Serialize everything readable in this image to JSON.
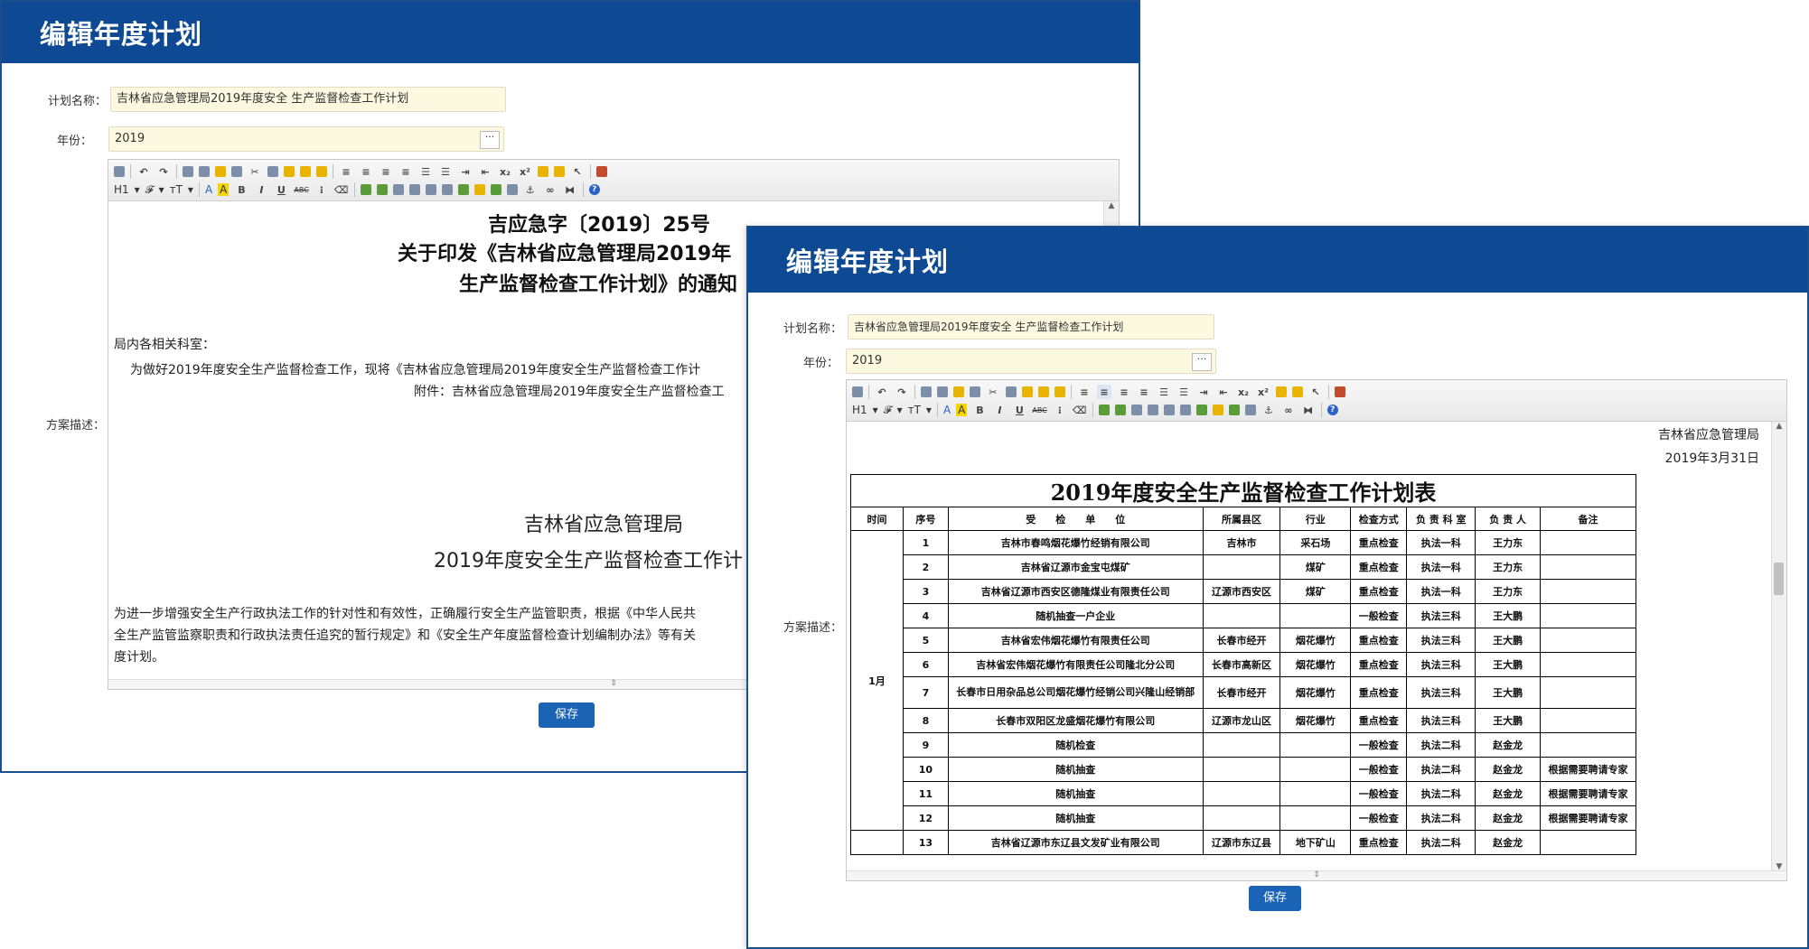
{
  "window_left": {
    "title": "编辑年度计划",
    "plan_name_label": "计划名称：",
    "plan_name_value": "吉林省应急管理局2019年度安全 生产监督检查工作计划",
    "year_label": "年份：",
    "year_value": "2019",
    "desc_label": "方案描述：",
    "doc": {
      "number": "吉应急字〔2019〕25号",
      "title_line1": "关于印发《吉林省应急管理局2019年",
      "title_line2": "生产监督检查工作计划》的通知",
      "greeting": "局内各相关科室：",
      "body1": "为做好2019年度安全生产监督检查工作，现将《吉林省应急管理局2019年度安全生产监督检查工作计",
      "attachment": "附件：吉林省应急管理局2019年度安全生产监督检查工",
      "org": "吉林省应急管理局",
      "plan_title": "2019年度安全生产监督检查工作计",
      "body2_line1": "为进一步增强安全生产行政执法工作的针对性和有效性，正确履行安全生产监管职责，根据《中华人民共",
      "body2_line2": "全生产监管监察职责和行政执法责任追究的暂行规定》和《安全生产年度监督检查计划编制办法》等有关",
      "body2_line3": "度计划。"
    },
    "save_label": "保存"
  },
  "window_right": {
    "title": "编辑年度计划",
    "plan_name_label": "计划名称：",
    "plan_name_value": "吉林省应急管理局2019年度安全 生产监督检查工作计划",
    "year_label": "年份：",
    "year_value": "2019",
    "desc_label": "方案描述：",
    "header_org": "吉林省应急管理局",
    "header_date": "2019年3月31日",
    "table_title": "2019年度安全生产监督检查工作计划表",
    "columns": [
      "时间",
      "序号",
      "受　　检　　单　　位",
      "所属县区",
      "行业",
      "检查方式",
      "负 责 科 室",
      "负 责 人",
      "备注"
    ],
    "month": "1月",
    "rows": [
      {
        "no": "1",
        "unit": "吉林市春鸣烟花爆竹经销有限公司",
        "county": "吉林市",
        "industry": "采石场",
        "method": "重点检查",
        "dept": "执法一科",
        "person": "王力东",
        "note": ""
      },
      {
        "no": "2",
        "unit": "吉林省辽源市金宝屯煤矿",
        "county": "",
        "industry": "煤矿",
        "method": "重点检查",
        "dept": "执法一科",
        "person": "王力东",
        "note": ""
      },
      {
        "no": "3",
        "unit": "吉林省辽源市西安区德隆煤业有限责任公司",
        "county": "辽源市西安区",
        "industry": "煤矿",
        "method": "重点检查",
        "dept": "执法一科",
        "person": "王力东",
        "note": ""
      },
      {
        "no": "4",
        "unit": "随机抽查一户企业",
        "county": "",
        "industry": "",
        "method": "一般检查",
        "dept": "执法三科",
        "person": "王大鹏",
        "note": ""
      },
      {
        "no": "5",
        "unit": "吉林省宏伟烟花爆竹有限责任公司",
        "county": "长春市经开",
        "industry": "烟花爆竹",
        "method": "重点检查",
        "dept": "执法三科",
        "person": "王大鹏",
        "note": ""
      },
      {
        "no": "6",
        "unit": "吉林省宏伟烟花爆竹有限责任公司隆北分公司",
        "county": "长春市高新区",
        "industry": "烟花爆竹",
        "method": "重点检查",
        "dept": "执法三科",
        "person": "王大鹏",
        "note": ""
      },
      {
        "no": "7",
        "unit": "长春市日用杂品总公司烟花爆竹经销公司兴隆山经销部",
        "county": "长春市经开",
        "industry": "烟花爆竹",
        "method": "重点检查",
        "dept": "执法三科",
        "person": "王大鹏",
        "note": ""
      },
      {
        "no": "8",
        "unit": "长春市双阳区龙盛烟花爆竹有限公司",
        "county": "辽源市龙山区",
        "industry": "烟花爆竹",
        "method": "重点检查",
        "dept": "执法三科",
        "person": "王大鹏",
        "note": ""
      },
      {
        "no": "9",
        "unit": "随机检查",
        "county": "",
        "industry": "",
        "method": "一般检查",
        "dept": "执法二科",
        "person": "赵金龙",
        "note": ""
      },
      {
        "no": "10",
        "unit": "随机抽查",
        "county": "",
        "industry": "",
        "method": "一般检查",
        "dept": "执法二科",
        "person": "赵金龙",
        "note": "根据需要聘请专家"
      },
      {
        "no": "11",
        "unit": "随机抽查",
        "county": "",
        "industry": "",
        "method": "一般检查",
        "dept": "执法二科",
        "person": "赵金龙",
        "note": "根据需要聘请专家"
      },
      {
        "no": "12",
        "unit": "随机抽查",
        "county": "",
        "industry": "",
        "method": "一般检查",
        "dept": "执法二科",
        "person": "赵金龙",
        "note": "根据需要聘请专家"
      },
      {
        "no": "13",
        "unit": "吉林省辽源市东辽县文发矿业有限公司",
        "county": "辽源市东辽县",
        "industry": "地下矿山",
        "method": "重点检查",
        "dept": "执法二科",
        "person": "赵金龙",
        "note": ""
      }
    ],
    "save_label": "保存"
  },
  "toolbar": {
    "h1": "H1",
    "font": "𝓕",
    "size": "тT",
    "fontcolor": "A",
    "bgcolor": "A",
    "bold": "B",
    "italic": "I",
    "underline": "U",
    "strike": "ABC",
    "help": "?"
  },
  "colors": {
    "titlebar": "#0d4a93",
    "button": "#1a63b5",
    "input_bg": "#fcf9e0"
  }
}
